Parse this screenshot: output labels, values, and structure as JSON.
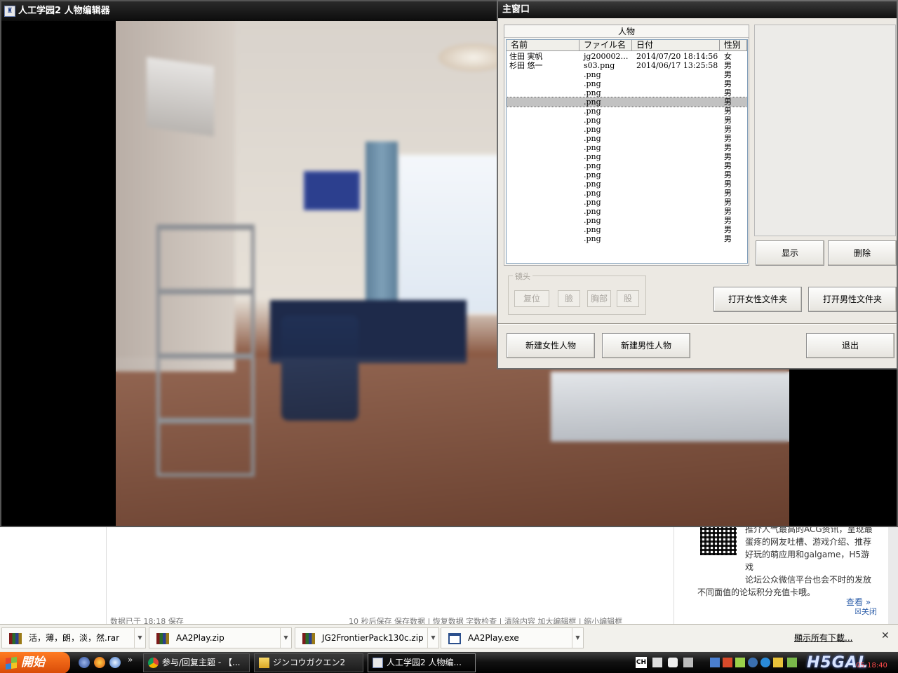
{
  "game_window": {
    "title": "人工学园2 人物编辑器",
    "icon": "game-app-icon"
  },
  "main_dialog": {
    "title": "主窗口",
    "characters_group": "人物",
    "columns": [
      "名前",
      "ファイル名",
      "日付",
      "性别"
    ],
    "rows": [
      {
        "name": "住田 実帆",
        "file": "jg2000020...",
        "date": "2014/07/20 18:14:56",
        "sex": "女"
      },
      {
        "name": "杉田 悠一",
        "file": "s03.png",
        "date": "2014/06/17 13:25:58",
        "sex": "男"
      },
      {
        "name": "",
        "file": ".png",
        "date": "",
        "sex": "男"
      },
      {
        "name": "",
        "file": ".png",
        "date": "",
        "sex": "男"
      },
      {
        "name": "",
        "file": ".png",
        "date": "",
        "sex": "男"
      },
      {
        "name": "",
        "file": ".png",
        "date": "",
        "sex": "男"
      },
      {
        "name": "",
        "file": ".png",
        "date": "",
        "sex": "男"
      },
      {
        "name": "",
        "file": ".png",
        "date": "",
        "sex": "男"
      },
      {
        "name": "",
        "file": ".png",
        "date": "",
        "sex": "男"
      },
      {
        "name": "",
        "file": ".png",
        "date": "",
        "sex": "男"
      },
      {
        "name": "",
        "file": ".png",
        "date": "",
        "sex": "男"
      },
      {
        "name": "",
        "file": ".png",
        "date": "",
        "sex": "男"
      },
      {
        "name": "",
        "file": ".png",
        "date": "",
        "sex": "男"
      },
      {
        "name": "",
        "file": ".png",
        "date": "",
        "sex": "男"
      },
      {
        "name": "",
        "file": ".png",
        "date": "",
        "sex": "男"
      },
      {
        "name": "",
        "file": ".png",
        "date": "",
        "sex": "男"
      },
      {
        "name": "",
        "file": ".png",
        "date": "",
        "sex": "男"
      },
      {
        "name": "",
        "file": ".png",
        "date": "",
        "sex": "男"
      },
      {
        "name": "",
        "file": ".png",
        "date": "",
        "sex": "男"
      },
      {
        "name": "",
        "file": ".png",
        "date": "",
        "sex": "男"
      },
      {
        "name": "",
        "file": ".png",
        "date": "",
        "sex": "男"
      }
    ],
    "selected_row": 5,
    "buttons": {
      "show": "显示",
      "delete": "删除",
      "open_female_folder": "打开女性文件夹",
      "open_male_folder": "打开男性文件夹",
      "new_female": "新建女性人物",
      "new_male": "新建男性人物",
      "exit": "退出"
    },
    "camera": {
      "legend": "镜头",
      "reset": "复位",
      "face": "臉",
      "chest": "胸部",
      "crotch": "股"
    }
  },
  "background_page": {
    "status_left": "数据已于 18:18 保存",
    "status_right": "10 秒后保存  保存数据 | 恢复数据    字数检查 | 清除内容    加大编辑框 | 缩小编辑框",
    "promo_lines": [
      "推介人气最高的ACG资讯，呈现最",
      "蛋疼的网友吐槽、游戏介绍、推荐",
      "好玩的萌应用和galgame，H5游戏",
      "论坛公众微信平台也会不时的发放",
      "不同面值的论坛积分充值卡哦。"
    ],
    "view_more": "查看 »",
    "close": "☒关闭"
  },
  "downloads": {
    "items": [
      {
        "name": "活，薄，朗，淡，然.rar",
        "icon": "rar-archive-icon"
      },
      {
        "name": "AA2Play.zip",
        "icon": "rar-archive-icon"
      },
      {
        "name": "JG2FrontierPack130c.zip",
        "icon": "rar-archive-icon"
      },
      {
        "name": "AA2Play.exe",
        "icon": "exe-file-icon"
      }
    ],
    "show_all": "顯示所有下載..."
  },
  "taskbar": {
    "start_label": "開始",
    "tasks": [
      {
        "label": "参与/回复主题 - 【...",
        "icon": "chrome-icon"
      },
      {
        "label": "ジンコウガクエン2",
        "icon": "folder-icon"
      },
      {
        "label": "人工学园2 人物编...",
        "icon": "game-app-icon"
      }
    ],
    "lang": "CH",
    "watermark": "H5GAL",
    "clock": "05:18:40"
  }
}
